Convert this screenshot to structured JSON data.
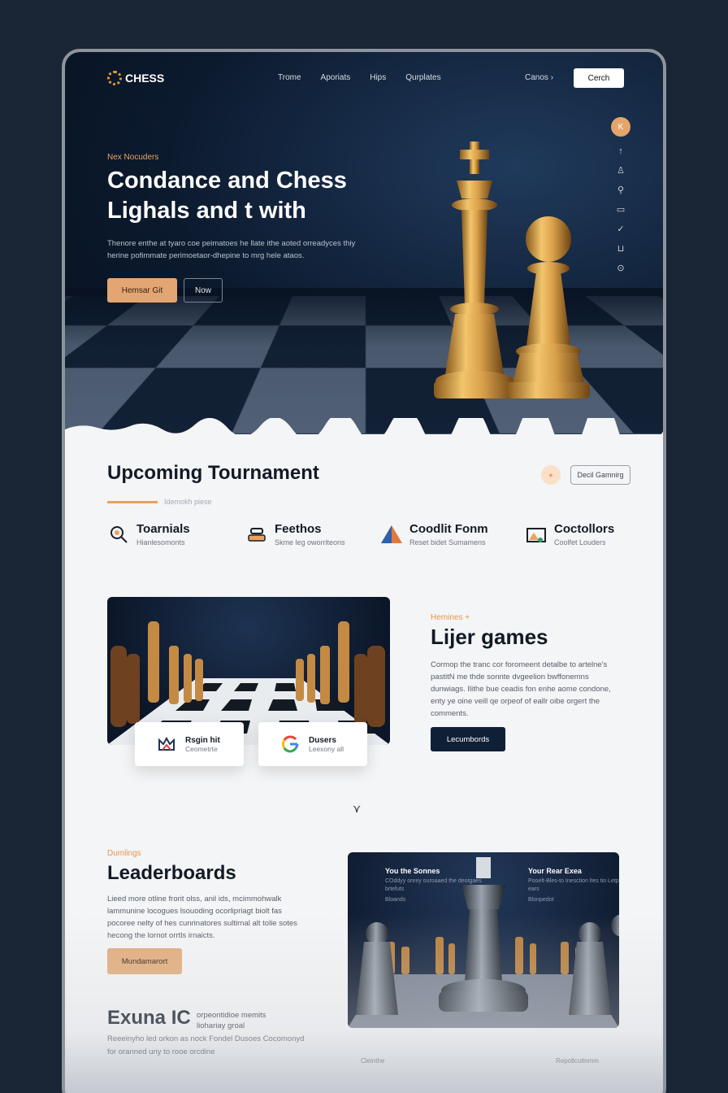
{
  "nav": {
    "logo": "CHESS",
    "links": [
      "Trome",
      "Aporiats",
      "Hips",
      "Qurplates"
    ],
    "right_link": "Canos",
    "cta": "Cerch"
  },
  "side_icons": [
    "k-icon",
    "arrow-up-icon",
    "user-icon",
    "tree-icon",
    "rect-icon",
    "check-icon",
    "clip-icon",
    "play-icon"
  ],
  "hero": {
    "eyebrow": "Nex Nocuders",
    "title_line1": "Condance and Chess",
    "title_line2": "Lighals and t with",
    "description": "Thenore enthe at tyaro coe peimatoes he llate ithe aoted orreadyces thiy herine pofimmate perimoetaor-dhepine to mrg hele ataos.",
    "primary_button": "Hemsar Git",
    "secondary_button": "Now"
  },
  "tournament": {
    "title": "Upcoming Tournament",
    "subtitle": "Idemokh piese",
    "pill_button": "Decil Gamnirg",
    "features": [
      {
        "title": "Toarnials",
        "sub": "Hianlesomonts"
      },
      {
        "title": "Feethos",
        "sub": "Skme leg oworriteons"
      },
      {
        "title": "Coodlit Fonm",
        "sub": "Reset bidet Sumamens"
      },
      {
        "title": "Coctollors",
        "sub": "Coolfet Louders"
      }
    ]
  },
  "live": {
    "mini_cards": [
      {
        "title": "Rsgin hit",
        "sub": "Ceometrte"
      },
      {
        "title": "Dusers",
        "sub": "Leexony all"
      }
    ],
    "eyebrow": "Hemines +",
    "title": "Lijer games",
    "description": "Cormop the tranc cor foromeent detalbe to artelne's pastitN me thde sonnte dvgeelion bwffonemns dunwiags. Ilithe bue ceadis fon enhe aome condone, enty ye oine veill qe orpeof of eallr oibe orgert the comments.",
    "button": "Lecumbords"
  },
  "leaderboards": {
    "eyebrow": "Dumlings",
    "title": "Leaderboards",
    "description": "Lieed more otline frorit olss, anil ids, mcimmohwalk lammunine locogues lsouoding ocorlipriagt biolt fas pocoree nelty of hes cunrinatores sultirnal alt tolie sotes hecong the lornot orrtls irnaicts.",
    "button": "Mundamarort",
    "panel_left_title": "You the Sonnes",
    "panel_left_sub": "COddyy onrey ouroaaed the deotgaes brtefuts",
    "panel_left_sub2": "Bloands",
    "panel_right_title": "Your Rear Exea",
    "panel_right_sub": "Pooelt-Bles-to Inesction ltes tio Letpeg ears",
    "panel_right_sub2": "Blonpedot"
  },
  "footer": {
    "title": "Exuna IC",
    "title_sub": "orpeontidioe memits liohariay groal",
    "description": "Reeeinyho led orkon as nock Fondel Dusoes Cocomonyd for oranned uny to rooe orcdine",
    "faint1": "Cleinthe",
    "faint2": "Repollcuitnmm"
  },
  "colors": {
    "accent": "#e8a262",
    "navy": "#0f2036",
    "page_bg": "#1a2535"
  }
}
